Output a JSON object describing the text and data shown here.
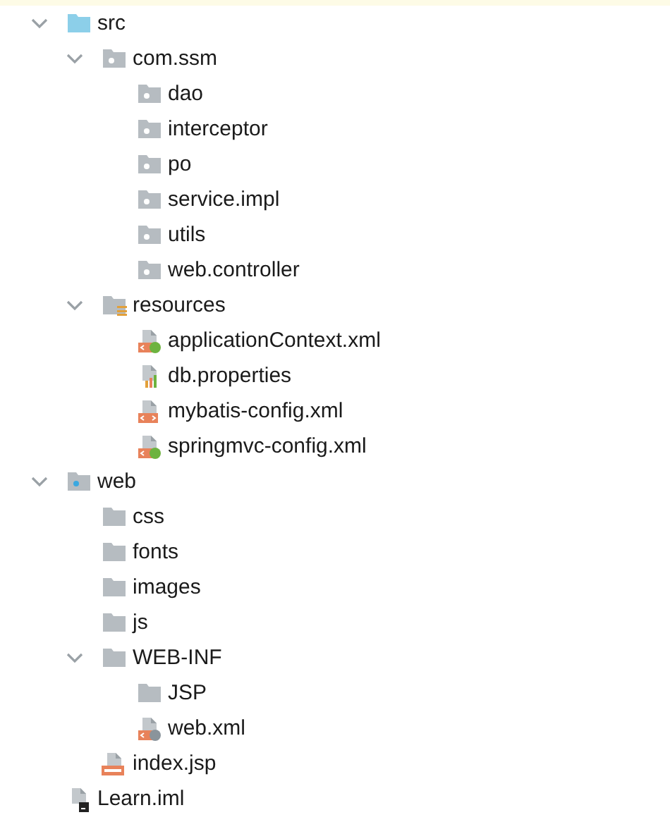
{
  "tree": [
    {
      "label": "src",
      "kind": "source-folder",
      "expanded": true,
      "children": [
        {
          "label": "com.ssm",
          "kind": "package",
          "expanded": true,
          "children": [
            {
              "label": "dao",
              "kind": "package"
            },
            {
              "label": "interceptor",
              "kind": "package"
            },
            {
              "label": "po",
              "kind": "package"
            },
            {
              "label": "service.impl",
              "kind": "package"
            },
            {
              "label": "utils",
              "kind": "package"
            },
            {
              "label": "web.controller",
              "kind": "package"
            }
          ]
        },
        {
          "label": "resources",
          "kind": "resources-folder",
          "expanded": true,
          "children": [
            {
              "label": "applicationContext.xml",
              "kind": "spring-xml"
            },
            {
              "label": "db.properties",
              "kind": "properties"
            },
            {
              "label": "mybatis-config.xml",
              "kind": "xml"
            },
            {
              "label": "springmvc-config.xml",
              "kind": "spring-xml"
            }
          ]
        }
      ]
    },
    {
      "label": "web",
      "kind": "web-folder",
      "expanded": true,
      "children": [
        {
          "label": "css",
          "kind": "folder"
        },
        {
          "label": "fonts",
          "kind": "folder"
        },
        {
          "label": "images",
          "kind": "folder"
        },
        {
          "label": "js",
          "kind": "folder"
        },
        {
          "label": "WEB-INF",
          "kind": "folder",
          "expanded": true,
          "children": [
            {
              "label": "JSP",
              "kind": "folder"
            },
            {
              "label": "web.xml",
              "kind": "web-xml"
            }
          ]
        },
        {
          "label": "index.jsp",
          "kind": "jsp"
        }
      ]
    },
    {
      "label": "Learn.iml",
      "kind": "iml"
    }
  ]
}
